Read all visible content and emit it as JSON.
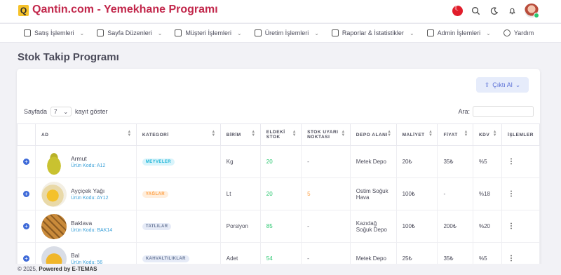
{
  "header": {
    "logo_letter": "Q",
    "brand": "Qantin.com - Yemekhane Programı",
    "icons": [
      "turkey-flag-icon",
      "search-icon",
      "moon-icon",
      "bell-icon",
      "avatar"
    ]
  },
  "nav": {
    "items": [
      {
        "label": "Satış İşlemleri",
        "icon": "camera-icon"
      },
      {
        "label": "Sayfa Düzenleri",
        "icon": "layout-icon"
      },
      {
        "label": "Müşteri İşlemleri",
        "icon": "lock-icon"
      },
      {
        "label": "Üretim İşlemleri",
        "icon": "home-icon"
      },
      {
        "label": "Raporlar & İstatistikler",
        "icon": "report-icon"
      },
      {
        "label": "Admin İşlemleri",
        "icon": "grid-icon"
      },
      {
        "label": "Yardım",
        "icon": "help-icon"
      }
    ]
  },
  "page": {
    "title": "Stok Takip Programı"
  },
  "toolbar": {
    "export_label": "Çıktı Al",
    "length_prefix": "Sayfada",
    "length_value": "7",
    "length_suffix": "kayıt göster",
    "search_label": "Ara:",
    "search_value": ""
  },
  "table": {
    "headers": [
      "AD",
      "KATEGORİ",
      "BİRİM",
      "ELDEKİ STOK",
      "STOK UYARI NOKTASI",
      "DEPO ALANI",
      "MALİYET",
      "FİYAT",
      "KDV",
      "İŞLEMLER"
    ],
    "rows": [
      {
        "name": "Armut",
        "code": "Ürün Kodu: A12",
        "category": "MEYVELER",
        "unit": "Kg",
        "stock": "20",
        "alert": "-",
        "depot": "Metek Depo",
        "cost": "20₺",
        "price": "35₺",
        "vat": "%5"
      },
      {
        "name": "Ayçiçek Yağı",
        "code": "Ürün Kodu: AY12",
        "category": "YAĞLAR",
        "unit": "Lt",
        "stock": "20",
        "alert": "5",
        "depot": "Ostim Soğuk Hava",
        "cost": "100₺",
        "price": "-",
        "vat": "%18"
      },
      {
        "name": "Baklava",
        "code": "Ürün Kodu: BAK14",
        "category": "TATLILAR",
        "unit": "Porsiyon",
        "stock": "85",
        "alert": "-",
        "depot": "Kazıdağ Soğuk Depo",
        "cost": "100₺",
        "price": "200₺",
        "vat": "%20"
      },
      {
        "name": "Bal",
        "code": "Ürün Kodu: 56",
        "category": "KAHVALTILIKLAR",
        "unit": "Adet",
        "stock": "54",
        "alert": "-",
        "depot": "Metek Depo",
        "cost": "25₺",
        "price": "35₺",
        "vat": "%5"
      }
    ]
  },
  "footer": {
    "prefix": "© 2025,",
    "powered": "Powered by E-TEMAS"
  },
  "colors": {
    "brand": "#c2274b",
    "accent": "#3e6ad8",
    "stock_green": "#28c76f",
    "alert_orange": "#ff9f43"
  }
}
